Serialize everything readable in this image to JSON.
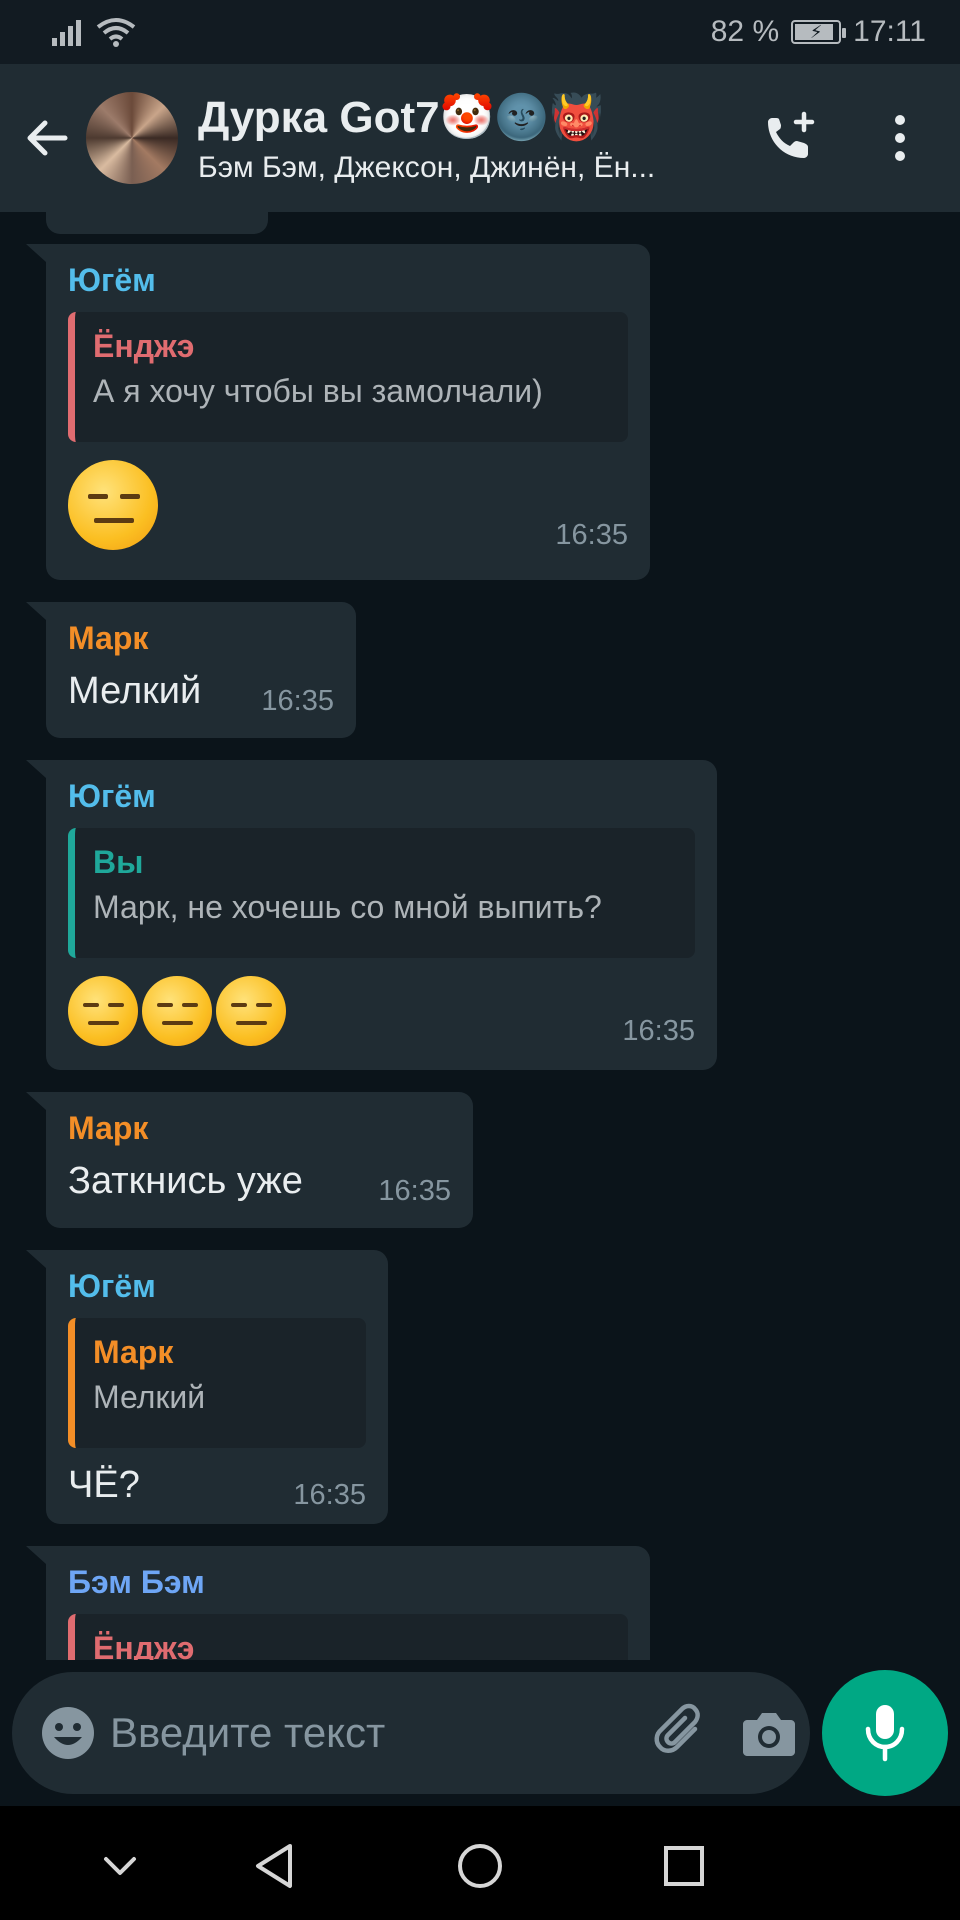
{
  "status_bar": {
    "battery": "82 %",
    "battery_level_pct": 82,
    "time": "17:11"
  },
  "header": {
    "title": "Дурка Got7🤡🌚👹",
    "subtitle": "Бэм Бэм, Джексон, Джинён, Ён..."
  },
  "messages": [
    {
      "sender": "Югём",
      "quote": {
        "name": "Ёнджэ",
        "text": "А я хочу чтобы вы замолчали)"
      },
      "emoji_count": 1,
      "time": "16:35"
    },
    {
      "sender": "Марк",
      "text": "Мелкий",
      "time": "16:35"
    },
    {
      "sender": "Югём",
      "quote": {
        "name": "Вы",
        "text": "Марк, не хочешь со мной выпить?"
      },
      "emoji_count": 3,
      "time": "16:35"
    },
    {
      "sender": "Марк",
      "text": "Заткнись уже",
      "time": "16:35"
    },
    {
      "sender": "Югём",
      "quote": {
        "name": "Марк",
        "text": "Мелкий"
      },
      "text": "ЧЁ?",
      "time": "16:35"
    },
    {
      "sender": "Бэм Бэм",
      "quote": {
        "name": "Ёнджэ"
      }
    }
  ],
  "input": {
    "placeholder": "Введите текст"
  },
  "colors": {
    "accent": "#00a884",
    "sender_yugem": "#53bdeb",
    "sender_mark": "#f38e27",
    "sender_bem": "#6ea6f5",
    "quote_enje": "#e06c70",
    "quote_you": "#1fa89a"
  },
  "icons": [
    "back-arrow-icon",
    "add-call-icon",
    "more-vertical-icon",
    "double-chevron-down-icon",
    "emoji-icon",
    "paperclip-icon",
    "camera-icon",
    "microphone-icon",
    "nav-down-icon",
    "nav-back-icon",
    "nav-home-icon",
    "nav-recents-icon"
  ]
}
